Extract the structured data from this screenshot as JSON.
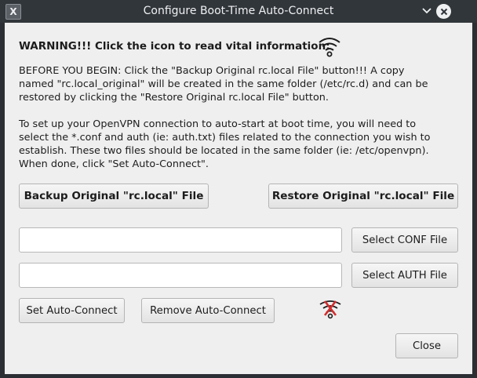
{
  "window": {
    "title": "Configure Boot-Time Auto-Connect",
    "app_icon": "X",
    "controls": [
      "chevron-down-icon",
      "close-icon"
    ]
  },
  "warning_text": "WARNING!!!  Click the icon to read vital information:",
  "paragraph1": {
    "line1": "BEFORE YOU BEGIN:  Click the \"Backup Original rc.local File\" button!!!  A copy",
    "line2": "named \"rc.local_original\" will be created in the same folder (/etc/rc.d) and can be",
    "line3": "restored by clicking the \"Restore Original rc.local File\" button."
  },
  "paragraph2": {
    "line1": "To set up your OpenVPN connection to auto-start at boot time, you will need to",
    "line2": "select the *.conf and auth (ie: auth.txt) files related to the connection you wish to",
    "line3": "establish.  These two files should be located in the same folder (ie: /etc/openvpn).",
    "line4": "When done, click \"Set Auto-Connect\"."
  },
  "buttons": {
    "backup": "Backup Original \"rc.local\" File",
    "restore": "Restore Original \"rc.local\" File",
    "select_conf": "Select CONF File",
    "select_auth": "Select AUTH File",
    "set_auto": "Set Auto-Connect",
    "remove_auto": "Remove Auto-Connect",
    "close": "Close"
  },
  "fields": {
    "conf_path": "",
    "auth_path": ""
  },
  "colors": {
    "titlebar": "#31363b",
    "dialog_bg": "#efefef",
    "disconnect_red": "#d42c2c"
  },
  "icons": {
    "info": "wifi-signal-icon",
    "status": "wifi-disconnected-icon"
  }
}
